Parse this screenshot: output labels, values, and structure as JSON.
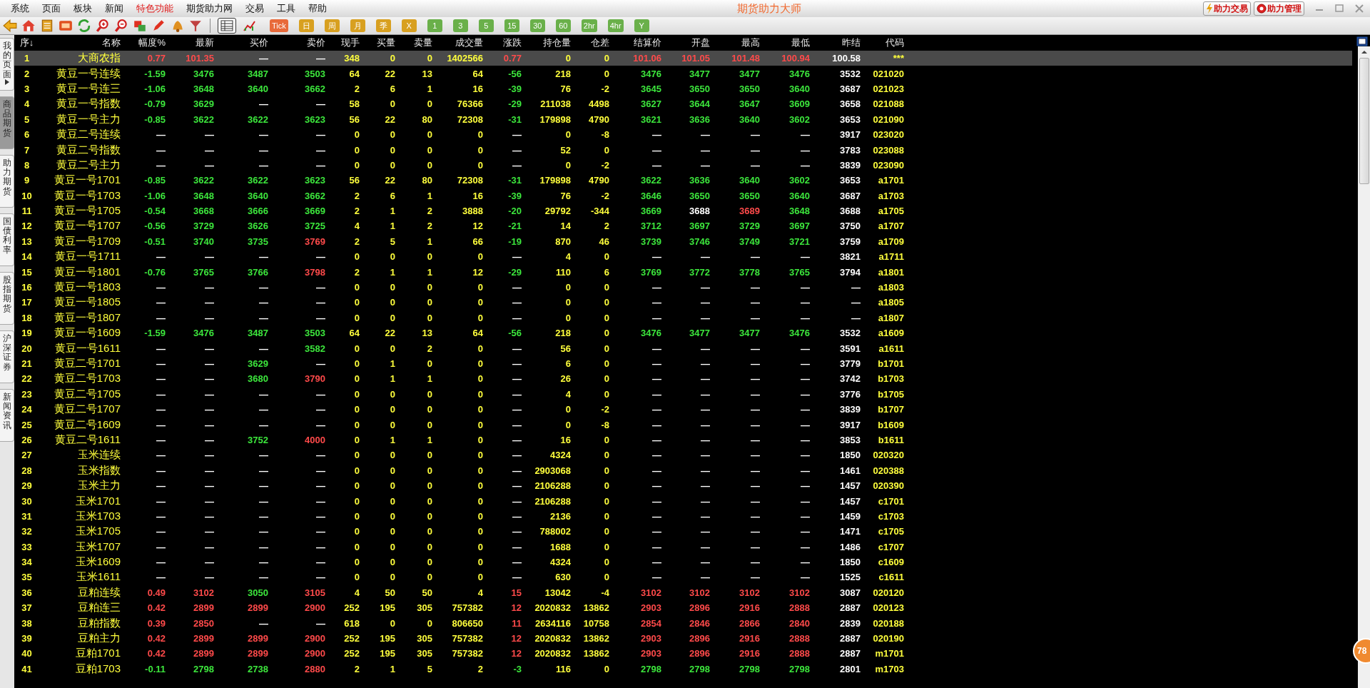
{
  "menu": [
    {
      "label": "系统",
      "highlighted": false
    },
    {
      "label": "页面",
      "highlighted": false
    },
    {
      "label": "板块",
      "highlighted": false
    },
    {
      "label": "新闻",
      "highlighted": false
    },
    {
      "label": "特色功能",
      "highlighted": true
    },
    {
      "label": "期货助力网",
      "highlighted": false
    },
    {
      "label": "交易",
      "highlighted": false
    },
    {
      "label": "工具",
      "highlighted": false
    },
    {
      "label": "帮助",
      "highlighted": false
    }
  ],
  "window": {
    "title": "期货助力大师"
  },
  "header_buttons": [
    {
      "label": "助力交易",
      "kind": "bolt"
    },
    {
      "label": "助力管理",
      "kind": "gear"
    }
  ],
  "view_toggle": [
    {
      "kind": "table",
      "selected": true
    },
    {
      "kind": "chart",
      "selected": false
    }
  ],
  "periods": [
    {
      "label": "Tick",
      "kind": "tick"
    },
    {
      "label": "日",
      "kind": "cycle"
    },
    {
      "label": "周",
      "kind": "cycle"
    },
    {
      "label": "月",
      "kind": "cycle"
    },
    {
      "label": "季",
      "kind": "cycle"
    },
    {
      "label": "X",
      "kind": "cycle"
    },
    {
      "label": "1",
      "kind": "minute"
    },
    {
      "label": "3",
      "kind": "minute"
    },
    {
      "label": "5",
      "kind": "minute"
    },
    {
      "label": "15",
      "kind": "minute"
    },
    {
      "label": "30",
      "kind": "minute"
    },
    {
      "label": "60",
      "kind": "minute"
    },
    {
      "label": "2hr",
      "kind": "minute"
    },
    {
      "label": "4hr",
      "kind": "minute"
    },
    {
      "label": "Y",
      "kind": "minute"
    }
  ],
  "side_tabs": [
    {
      "label": "我的页面",
      "selected": false,
      "expandable": true
    },
    {
      "label": "商品期货",
      "selected": true,
      "expandable": false
    },
    {
      "label": "助力期货",
      "selected": false,
      "expandable": false
    },
    {
      "label": "国债利率",
      "selected": false,
      "expandable": false
    },
    {
      "label": "股指期货",
      "selected": false,
      "expandable": false
    },
    {
      "label": "沪深证券",
      "selected": false,
      "expandable": false
    },
    {
      "label": "新闻资讯",
      "selected": false,
      "expandable": false
    }
  ],
  "table": {
    "columns": [
      {
        "label": "序↓",
        "kind": "index"
      },
      {
        "label": "名称",
        "kind": "name"
      },
      {
        "label": "幅度%",
        "kind": "change"
      },
      {
        "label": "最新",
        "kind": "price"
      },
      {
        "label": "买价",
        "kind": "price"
      },
      {
        "label": "卖价",
        "kind": "price"
      },
      {
        "label": "现手",
        "kind": "volume"
      },
      {
        "label": "买量",
        "kind": "volume"
      },
      {
        "label": "卖量",
        "kind": "volume"
      },
      {
        "label": "成交量",
        "kind": "volume"
      },
      {
        "label": "涨跌",
        "kind": "change"
      },
      {
        "label": "持仓量",
        "kind": "volume"
      },
      {
        "label": "仓差",
        "kind": "volume"
      },
      {
        "label": "结算价",
        "kind": "price"
      },
      {
        "label": "开盘",
        "kind": "price"
      },
      {
        "label": "最高",
        "kind": "price"
      },
      {
        "label": "最低",
        "kind": "price"
      },
      {
        "label": "昨结",
        "kind": "reference"
      },
      {
        "label": "代码",
        "kind": "code"
      }
    ],
    "rows": [
      {
        "selected": true,
        "cells": [
          "1",
          "大商农指",
          "0.77",
          "101.35",
          "—",
          "—",
          "348",
          "0",
          "0",
          "1402566",
          "0.77",
          "0",
          "0",
          "101.06",
          "101.05",
          "101.48",
          "100.94",
          "100.58",
          "***"
        ]
      },
      {
        "selected": false,
        "cells": [
          "2",
          "黄豆一号连续",
          "-1.59",
          "3476",
          "3487",
          "3503",
          "64",
          "22",
          "13",
          "64",
          "-56",
          "218",
          "0",
          "3476",
          "3477",
          "3477",
          "3476",
          "3532",
          "021020"
        ]
      },
      {
        "selected": false,
        "cells": [
          "3",
          "黄豆一号连三",
          "-1.06",
          "3648",
          "3640",
          "3662",
          "2",
          "6",
          "1",
          "16",
          "-39",
          "76",
          "-2",
          "3645",
          "3650",
          "3650",
          "3640",
          "3687",
          "021023"
        ]
      },
      {
        "selected": false,
        "cells": [
          "4",
          "黄豆一号指数",
          "-0.79",
          "3629",
          "—",
          "—",
          "58",
          "0",
          "0",
          "76366",
          "-29",
          "211038",
          "4498",
          "3627",
          "3644",
          "3647",
          "3609",
          "3658",
          "021088"
        ]
      },
      {
        "selected": false,
        "cells": [
          "5",
          "黄豆一号主力",
          "-0.85",
          "3622",
          "3622",
          "3623",
          "56",
          "22",
          "80",
          "72308",
          "-31",
          "179898",
          "4790",
          "3621",
          "3636",
          "3640",
          "3602",
          "3653",
          "021090"
        ]
      },
      {
        "selected": false,
        "cells": [
          "6",
          "黄豆二号连续",
          "—",
          "—",
          "—",
          "—",
          "0",
          "0",
          "0",
          "0",
          "—",
          "0",
          "-8",
          "—",
          "—",
          "—",
          "—",
          "3917",
          "023020"
        ]
      },
      {
        "selected": false,
        "cells": [
          "7",
          "黄豆二号指数",
          "—",
          "—",
          "—",
          "—",
          "0",
          "0",
          "0",
          "0",
          "—",
          "52",
          "0",
          "—",
          "—",
          "—",
          "—",
          "3783",
          "023088"
        ]
      },
      {
        "selected": false,
        "cells": [
          "8",
          "黄豆二号主力",
          "—",
          "—",
          "—",
          "—",
          "0",
          "0",
          "0",
          "0",
          "—",
          "0",
          "-2",
          "—",
          "—",
          "—",
          "—",
          "3839",
          "023090"
        ]
      },
      {
        "selected": false,
        "cells": [
          "9",
          "黄豆一号1701",
          "-0.85",
          "3622",
          "3622",
          "3623",
          "56",
          "22",
          "80",
          "72308",
          "-31",
          "179898",
          "4790",
          "3622",
          "3636",
          "3640",
          "3602",
          "3653",
          "a1701"
        ]
      },
      {
        "selected": false,
        "cells": [
          "10",
          "黄豆一号1703",
          "-1.06",
          "3648",
          "3640",
          "3662",
          "2",
          "6",
          "1",
          "16",
          "-39",
          "76",
          "-2",
          "3646",
          "3650",
          "3650",
          "3640",
          "3687",
          "a1703"
        ]
      },
      {
        "selected": false,
        "cells": [
          "11",
          "黄豆一号1705",
          "-0.54",
          "3668",
          "3666",
          "3669",
          "2",
          "1",
          "2",
          "3888",
          "-20",
          "29792",
          "-344",
          "3669",
          "3688",
          "3689",
          "3648",
          "3688",
          "a1705"
        ]
      },
      {
        "selected": false,
        "cells": [
          "12",
          "黄豆一号1707",
          "-0.56",
          "3729",
          "3626",
          "3725",
          "4",
          "1",
          "2",
          "12",
          "-21",
          "14",
          "2",
          "3712",
          "3697",
          "3729",
          "3697",
          "3750",
          "a1707"
        ]
      },
      {
        "selected": false,
        "cells": [
          "13",
          "黄豆一号1709",
          "-0.51",
          "3740",
          "3735",
          "3769",
          "2",
          "5",
          "1",
          "66",
          "-19",
          "870",
          "46",
          "3739",
          "3746",
          "3749",
          "3721",
          "3759",
          "a1709"
        ]
      },
      {
        "selected": false,
        "cells": [
          "14",
          "黄豆一号1711",
          "—",
          "—",
          "—",
          "—",
          "0",
          "0",
          "0",
          "0",
          "—",
          "4",
          "0",
          "—",
          "—",
          "—",
          "—",
          "3821",
          "a1711"
        ]
      },
      {
        "selected": false,
        "cells": [
          "15",
          "黄豆一号1801",
          "-0.76",
          "3765",
          "3766",
          "3798",
          "2",
          "1",
          "1",
          "12",
          "-29",
          "110",
          "6",
          "3769",
          "3772",
          "3778",
          "3765",
          "3794",
          "a1801"
        ]
      },
      {
        "selected": false,
        "cells": [
          "16",
          "黄豆一号1803",
          "—",
          "—",
          "—",
          "—",
          "0",
          "0",
          "0",
          "0",
          "—",
          "0",
          "0",
          "—",
          "—",
          "—",
          "—",
          "—",
          "a1803"
        ]
      },
      {
        "selected": false,
        "cells": [
          "17",
          "黄豆一号1805",
          "—",
          "—",
          "—",
          "—",
          "0",
          "0",
          "0",
          "0",
          "—",
          "0",
          "0",
          "—",
          "—",
          "—",
          "—",
          "—",
          "a1805"
        ]
      },
      {
        "selected": false,
        "cells": [
          "18",
          "黄豆一号1807",
          "—",
          "—",
          "—",
          "—",
          "0",
          "0",
          "0",
          "0",
          "—",
          "0",
          "0",
          "—",
          "—",
          "—",
          "—",
          "—",
          "a1807"
        ]
      },
      {
        "selected": false,
        "cells": [
          "19",
          "黄豆一号1609",
          "-1.59",
          "3476",
          "3487",
          "3503",
          "64",
          "22",
          "13",
          "64",
          "-56",
          "218",
          "0",
          "3476",
          "3477",
          "3477",
          "3476",
          "3532",
          "a1609"
        ]
      },
      {
        "selected": false,
        "cells": [
          "20",
          "黄豆一号1611",
          "—",
          "—",
          "—",
          "3582",
          "0",
          "0",
          "2",
          "0",
          "—",
          "56",
          "0",
          "—",
          "—",
          "—",
          "—",
          "3591",
          "a1611"
        ]
      },
      {
        "selected": false,
        "cells": [
          "21",
          "黄豆二号1701",
          "—",
          "—",
          "3629",
          "—",
          "0",
          "1",
          "0",
          "0",
          "—",
          "6",
          "0",
          "—",
          "—",
          "—",
          "—",
          "3779",
          "b1701"
        ]
      },
      {
        "selected": false,
        "cells": [
          "22",
          "黄豆二号1703",
          "—",
          "—",
          "3680",
          "3790",
          "0",
          "1",
          "1",
          "0",
          "—",
          "26",
          "0",
          "—",
          "—",
          "—",
          "—",
          "3742",
          "b1703"
        ]
      },
      {
        "selected": false,
        "cells": [
          "23",
          "黄豆二号1705",
          "—",
          "—",
          "—",
          "—",
          "0",
          "0",
          "0",
          "0",
          "—",
          "4",
          "0",
          "—",
          "—",
          "—",
          "—",
          "3776",
          "b1705"
        ]
      },
      {
        "selected": false,
        "cells": [
          "24",
          "黄豆二号1707",
          "—",
          "—",
          "—",
          "—",
          "0",
          "0",
          "0",
          "0",
          "—",
          "0",
          "-2",
          "—",
          "—",
          "—",
          "—",
          "3839",
          "b1707"
        ]
      },
      {
        "selected": false,
        "cells": [
          "25",
          "黄豆二号1609",
          "—",
          "—",
          "—",
          "—",
          "0",
          "0",
          "0",
          "0",
          "—",
          "0",
          "-8",
          "—",
          "—",
          "—",
          "—",
          "3917",
          "b1609"
        ]
      },
      {
        "selected": false,
        "cells": [
          "26",
          "黄豆二号1611",
          "—",
          "—",
          "3752",
          "4000",
          "0",
          "1",
          "1",
          "0",
          "—",
          "16",
          "0",
          "—",
          "—",
          "—",
          "—",
          "3853",
          "b1611"
        ]
      },
      {
        "selected": false,
        "cells": [
          "27",
          "玉米连续",
          "—",
          "—",
          "—",
          "—",
          "0",
          "0",
          "0",
          "0",
          "—",
          "4324",
          "0",
          "—",
          "—",
          "—",
          "—",
          "1850",
          "020320"
        ]
      },
      {
        "selected": false,
        "cells": [
          "28",
          "玉米指数",
          "—",
          "—",
          "—",
          "—",
          "0",
          "0",
          "0",
          "0",
          "—",
          "2903068",
          "0",
          "—",
          "—",
          "—",
          "—",
          "1461",
          "020388"
        ]
      },
      {
        "selected": false,
        "cells": [
          "29",
          "玉米主力",
          "—",
          "—",
          "—",
          "—",
          "0",
          "0",
          "0",
          "0",
          "—",
          "2106288",
          "0",
          "—",
          "—",
          "—",
          "—",
          "1457",
          "020390"
        ]
      },
      {
        "selected": false,
        "cells": [
          "30",
          "玉米1701",
          "—",
          "—",
          "—",
          "—",
          "0",
          "0",
          "0",
          "0",
          "—",
          "2106288",
          "0",
          "—",
          "—",
          "—",
          "—",
          "1457",
          "c1701"
        ]
      },
      {
        "selected": false,
        "cells": [
          "31",
          "玉米1703",
          "—",
          "—",
          "—",
          "—",
          "0",
          "0",
          "0",
          "0",
          "—",
          "2136",
          "0",
          "—",
          "—",
          "—",
          "—",
          "1459",
          "c1703"
        ]
      },
      {
        "selected": false,
        "cells": [
          "32",
          "玉米1705",
          "—",
          "—",
          "—",
          "—",
          "0",
          "0",
          "0",
          "0",
          "—",
          "788002",
          "0",
          "—",
          "—",
          "—",
          "—",
          "1471",
          "c1705"
        ]
      },
      {
        "selected": false,
        "cells": [
          "33",
          "玉米1707",
          "—",
          "—",
          "—",
          "—",
          "0",
          "0",
          "0",
          "0",
          "—",
          "1688",
          "0",
          "—",
          "—",
          "—",
          "—",
          "1486",
          "c1707"
        ]
      },
      {
        "selected": false,
        "cells": [
          "34",
          "玉米1609",
          "—",
          "—",
          "—",
          "—",
          "0",
          "0",
          "0",
          "0",
          "—",
          "4324",
          "0",
          "—",
          "—",
          "—",
          "—",
          "1850",
          "c1609"
        ]
      },
      {
        "selected": false,
        "cells": [
          "35",
          "玉米1611",
          "—",
          "—",
          "—",
          "—",
          "0",
          "0",
          "0",
          "0",
          "—",
          "630",
          "0",
          "—",
          "—",
          "—",
          "—",
          "1525",
          "c1611"
        ]
      },
      {
        "selected": false,
        "cells": [
          "36",
          "豆粕连续",
          "0.49",
          "3102",
          "3050",
          "3105",
          "4",
          "50",
          "50",
          "4",
          "15",
          "13042",
          "-4",
          "3102",
          "3102",
          "3102",
          "3102",
          "3087",
          "020120"
        ]
      },
      {
        "selected": false,
        "cells": [
          "37",
          "豆粕连三",
          "0.42",
          "2899",
          "2899",
          "2900",
          "252",
          "195",
          "305",
          "757382",
          "12",
          "2020832",
          "13862",
          "2903",
          "2896",
          "2916",
          "2888",
          "2887",
          "020123"
        ]
      },
      {
        "selected": false,
        "cells": [
          "38",
          "豆粕指数",
          "0.39",
          "2850",
          "—",
          "—",
          "618",
          "0",
          "0",
          "806650",
          "11",
          "2634116",
          "10758",
          "2854",
          "2846",
          "2866",
          "2840",
          "2839",
          "020188"
        ]
      },
      {
        "selected": false,
        "cells": [
          "39",
          "豆粕主力",
          "0.42",
          "2899",
          "2899",
          "2900",
          "252",
          "195",
          "305",
          "757382",
          "12",
          "2020832",
          "13862",
          "2903",
          "2896",
          "2916",
          "2888",
          "2887",
          "020190"
        ]
      },
      {
        "selected": false,
        "cells": [
          "40",
          "豆粕1701",
          "0.42",
          "2899",
          "2899",
          "2900",
          "252",
          "195",
          "305",
          "757382",
          "12",
          "2020832",
          "13862",
          "2903",
          "2896",
          "2916",
          "2888",
          "2887",
          "m1701"
        ]
      },
      {
        "selected": false,
        "cells": [
          "41",
          "豆粕1703",
          "-0.11",
          "2798",
          "2738",
          "2880",
          "2",
          "1",
          "5",
          "2",
          "-3",
          "116",
          "0",
          "2798",
          "2798",
          "2798",
          "2798",
          "2801",
          "m1703"
        ]
      }
    ]
  },
  "float_badge": {
    "label": "78"
  }
}
